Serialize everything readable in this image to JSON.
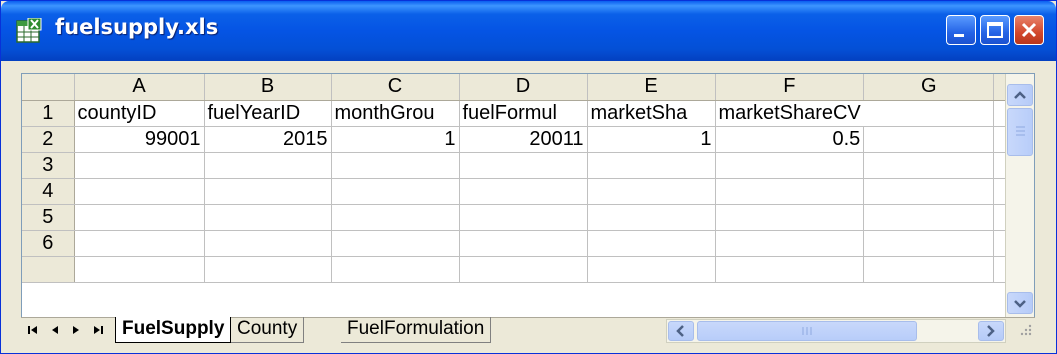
{
  "window": {
    "title": "fuelsupply.xls",
    "app_icon": "excel-workbook-icon",
    "controls": [
      "minimize-icon",
      "maximize-icon",
      "close-icon"
    ]
  },
  "columns": [
    "A",
    "B",
    "C",
    "D",
    "E",
    "F",
    "G"
  ],
  "rows": [
    {
      "num": "1",
      "cells": [
        "countyID",
        "fuelYearID",
        "monthGrou",
        "fuelFormul",
        "marketSha",
        "marketShareCV",
        ""
      ]
    },
    {
      "num": "2",
      "cells": [
        "99001",
        "2015",
        "1",
        "20011",
        "1",
        "0.5",
        ""
      ]
    },
    {
      "num": "3",
      "cells": [
        "",
        "",
        "",
        "",
        "",
        "",
        ""
      ]
    },
    {
      "num": "4",
      "cells": [
        "",
        "",
        "",
        "",
        "",
        "",
        ""
      ]
    },
    {
      "num": "5",
      "cells": [
        "",
        "",
        "",
        "",
        "",
        "",
        ""
      ]
    },
    {
      "num": "6",
      "cells": [
        "",
        "",
        "",
        "",
        "",
        "",
        ""
      ]
    }
  ],
  "sheet_tabs": [
    {
      "label": "FuelSupply",
      "active": true
    },
    {
      "label": "County",
      "active": false
    },
    {
      "label": "FuelFormulation",
      "active": false
    }
  ],
  "colors": {
    "titlebar": "#0554e4",
    "grid_header": "#ece9d8",
    "gridline": "#c0c0c0",
    "close_button": "#d2472c"
  }
}
